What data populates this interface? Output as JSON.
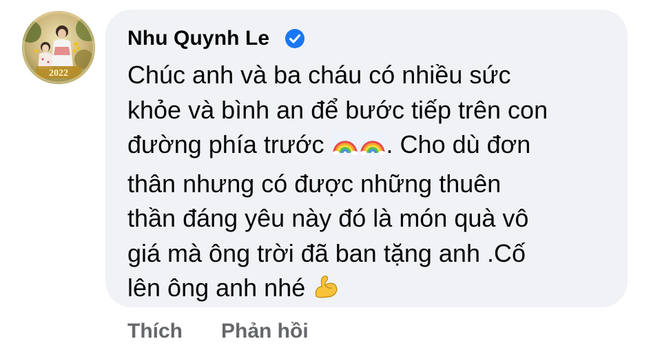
{
  "comment": {
    "author_name": "Nhu Quynh Le",
    "verified": true,
    "avatar_caption": "2022",
    "text_lines": [
      "Chúc anh và ba cháu có nhiều sức",
      "khỏe và bình an để bước tiếp trên con",
      "đường phía trước ",
      ". Cho dù đơn",
      "thân nhưng có được những thuên",
      "thần đáng yêu này đó là món quà vô",
      "giá mà ông trời đã ban tặng anh .Cố",
      "lên ông anh nhé "
    ],
    "emojis": {
      "rainbow": "🌈",
      "flexed_biceps": "💪"
    }
  },
  "actions": {
    "like_label": "Thích",
    "reply_label": "Phản hồi"
  },
  "colors": {
    "bubble_bg": "#f0f2f5",
    "text": "#050505",
    "action_text": "#65676b",
    "verified_blue": "#1877f2"
  },
  "icons": {
    "verified": "verified-badge-icon",
    "rainbow": "rainbow-emoji-icon",
    "biceps": "flexed-biceps-emoji-icon"
  }
}
